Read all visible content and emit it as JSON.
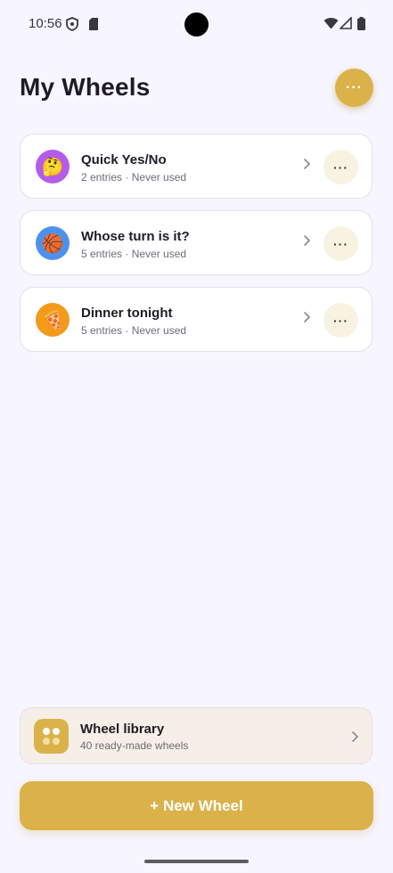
{
  "status_bar": {
    "time": "10:56"
  },
  "header": {
    "title": "My Wheels",
    "more_icon": "more-horizontal-icon",
    "accent": "#dbb24a"
  },
  "wheels": [
    {
      "emoji": "🤔",
      "color": "#b45ce9",
      "title": "Quick Yes/No",
      "subtitle": "2 entries · Never used"
    },
    {
      "emoji": "🏀",
      "color": "#4e91ec",
      "title": "Whose turn is it?",
      "subtitle": "5 entries · Never used"
    },
    {
      "emoji": "🍕",
      "color": "#f39a1c",
      "title": "Dinner tonight",
      "subtitle": "5 entries · Never used"
    }
  ],
  "library": {
    "title": "Wheel library",
    "subtitle": "40 ready-made wheels"
  },
  "new_wheel_button": "+ New Wheel"
}
